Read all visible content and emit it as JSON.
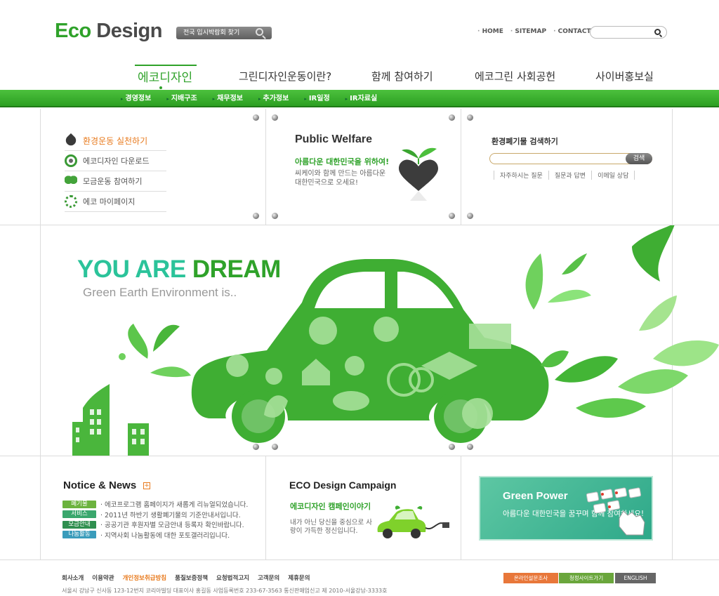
{
  "header": {
    "logo_eco": "Eco",
    "logo_design": "Design",
    "find_button": "전국 입시박람회 찾기",
    "util_links": [
      "HOME",
      "SITEMAP",
      "CONTACT US"
    ]
  },
  "gnb": {
    "items": [
      "에코디자인",
      "그린디자인운동이란?",
      "함께 참여하기",
      "에코그린 사회공헌",
      "사이버홍보실"
    ],
    "active": "에코디자인"
  },
  "subnav": {
    "items": [
      "경영정보",
      "지배구조",
      "채무정보",
      "추가정보",
      "IR일정",
      "IR자료실"
    ]
  },
  "quick_menu": {
    "items": [
      {
        "label": "환경운동 실천하기",
        "icon": "leaf-icon",
        "active": true
      },
      {
        "label": "에코디자인 다운로드",
        "icon": "ring-icon",
        "active": false
      },
      {
        "label": "모금운동 참여하기",
        "icon": "sprout-icon",
        "active": false
      },
      {
        "label": "에코 마이페이지",
        "icon": "recycle-icon",
        "active": false
      }
    ]
  },
  "public_welfare": {
    "title": "Public Welfare",
    "subtitle": "아름다운 대한민국을 위하여!",
    "desc": "씨케이와 함께 만드는 아름다운 대한민국으로 오세요!"
  },
  "recycle_search": {
    "title": "환경폐기물 검색하기",
    "button": "검색",
    "links": [
      "자주하시는 질문",
      "질문과 답변",
      "이메일 상담"
    ]
  },
  "hero": {
    "title_a": "YOU ARE",
    "title_b": "DREAM",
    "subtitle": "Green Earth Environment is.."
  },
  "notice": {
    "title": "Notice & News",
    "items": [
      {
        "tag": "폐기물",
        "color": "#6cb33e",
        "text": "· 에코프로그램 홈페이지가 새롭게 리뉴얼되었습니다."
      },
      {
        "tag": "서비스",
        "color": "#3aa76d",
        "text": "· 2011년 하반기 생활폐기물의 기준안내서입니다."
      },
      {
        "tag": "모금안내",
        "color": "#2f8f4f",
        "text": "· 공공기관 후원자별 모금안내 등록자 확인바랍니다."
      },
      {
        "tag": "나눔활동",
        "color": "#3a9cbb",
        "text": "· 지역사회 나눔활동에 대한 포토갤러리입니다."
      }
    ]
  },
  "campaign": {
    "title": "ECO Design Campaign",
    "subtitle": "에코디자인 캠페인이야기",
    "desc": "내가 아닌 당신을 중심으로 사랑이 가득한 정신입니다."
  },
  "green_power": {
    "title": "Green Power",
    "desc": "아름다운 대한민국을 꿈꾸며 함께 참여하세요!"
  },
  "footer": {
    "links": [
      "회사소개",
      "이용약관",
      "개인정보취급방침",
      "품질보증정책",
      "요청법적고지",
      "고객문의",
      "제휴문의"
    ],
    "address": "서울시 강남구 신사동 123-12번지 코리아빌딩  대표이사 홍길동 사업등록번호 233-67-3563 통신판매업신고 제 2010-서울강남-3333호",
    "btn1": "온라인설문조사",
    "btn2": "청정사이트가기",
    "btn3": "ENGLISH"
  },
  "colors": {
    "brand_green": "#2fa22a",
    "accent_orange": "#e87a1d",
    "mint": "#2bc39a"
  }
}
